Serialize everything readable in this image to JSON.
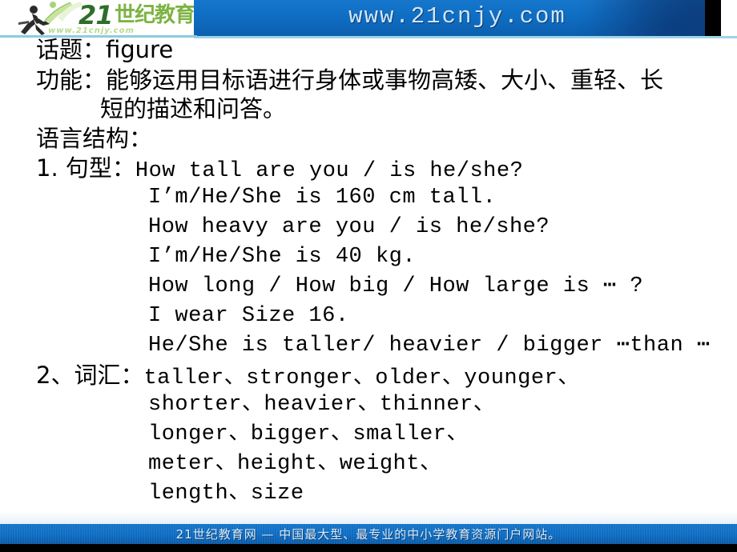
{
  "header": {
    "logo": {
      "number": "21",
      "cn_name": "世纪教育",
      "sub_url": "www.21cnjy.com",
      "runner_icon": "running-person-icon",
      "book_icon": "open-book-icon"
    },
    "site_url": "www.21cnjy.com",
    "banner_color": "#0f6ec4"
  },
  "slide": {
    "lines": [
      {
        "id": "topic",
        "text": "话题：figure"
      },
      {
        "id": "function1",
        "text": "功能：能够运用目标语进行身体或事物高矮、大小、重轻、长"
      },
      {
        "id": "function2",
        "text": "短的描述和问答。"
      },
      {
        "id": "structure",
        "text": "语言结构："
      },
      {
        "id": "pattern_label",
        "cn": "1. 句型：",
        "en": "How tall are you / is he/she?"
      },
      {
        "id": "pattern_2",
        "text": "I’m/He/She is 160 cm tall."
      },
      {
        "id": "pattern_3",
        "text": "How heavy are you / is he/she?"
      },
      {
        "id": "pattern_4",
        "text": "I’m/He/She is 40 kg."
      },
      {
        "id": "pattern_5",
        "text": "How long / How big / How large is ⋯ ?"
      },
      {
        "id": "pattern_6",
        "text": "I wear Size 16."
      },
      {
        "id": "pattern_7",
        "text": "He/She is taller/ heavier / bigger ⋯than ⋯"
      },
      {
        "id": "vocab_label",
        "cn": "2、词汇：",
        "en": "taller、stronger、older、younger、"
      },
      {
        "id": "vocab_2",
        "text": "shorter、heavier、thinner、"
      },
      {
        "id": "vocab_3",
        "text": "longer、bigger、smaller、"
      },
      {
        "id": "vocab_4",
        "text": "meter、height、weight、"
      },
      {
        "id": "vocab_5",
        "text": "length、size"
      }
    ]
  },
  "footer": {
    "text": "21世纪教育网 — 中国最大型、最专业的中小学教育资源门户网站。"
  }
}
